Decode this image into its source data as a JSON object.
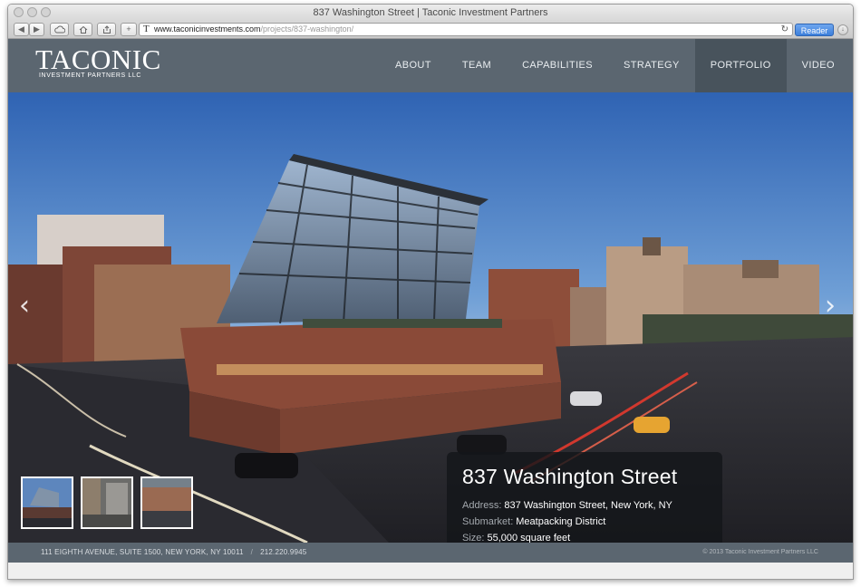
{
  "browser": {
    "window_title": "837 Washington Street | Taconic Investment Partners",
    "url_domain": "www.taconicinvestments.com",
    "url_path": "/projects/837-washington/",
    "reader_label": "Reader",
    "icons": [
      "back-arrow-icon",
      "forward-arrow-icon",
      "cloud-icon",
      "home-icon",
      "share-icon",
      "add-bookmark-icon",
      "reload-icon",
      "download-icon"
    ]
  },
  "site": {
    "logo_main": "TACONIC",
    "logo_sub": "INVESTMENT PARTNERS LLC",
    "nav": [
      {
        "label": "ABOUT"
      },
      {
        "label": "TEAM"
      },
      {
        "label": "CAPABILITIES"
      },
      {
        "label": "STRATEGY"
      },
      {
        "label": "PORTFOLIO"
      },
      {
        "label": "VIDEO"
      }
    ],
    "active_nav": "PORTFOLIO"
  },
  "hero": {
    "prev_arrow": "‹",
    "next_arrow": "›",
    "info": {
      "title": "837 Washington Street",
      "rows": [
        {
          "label": "Address:",
          "value": "837 Washington Street, New York, NY"
        },
        {
          "label": "Submarket:",
          "value": "Meatpacking District"
        },
        {
          "label": "Size:",
          "value": "55,000 square feet"
        }
      ]
    },
    "thumbnail_count": 3
  },
  "footer": {
    "address": "111 EIGHTH AVENUE, SUITE 1500, NEW YORK, NY 10011",
    "separator": "/",
    "phone": "212.220.9945",
    "copyright": "© 2013 Taconic Investment Partners LLC"
  },
  "colors": {
    "header_bg": "#5b6670",
    "nav_active_bg": "#48535c",
    "reader_blue": "#3d7fdb"
  }
}
